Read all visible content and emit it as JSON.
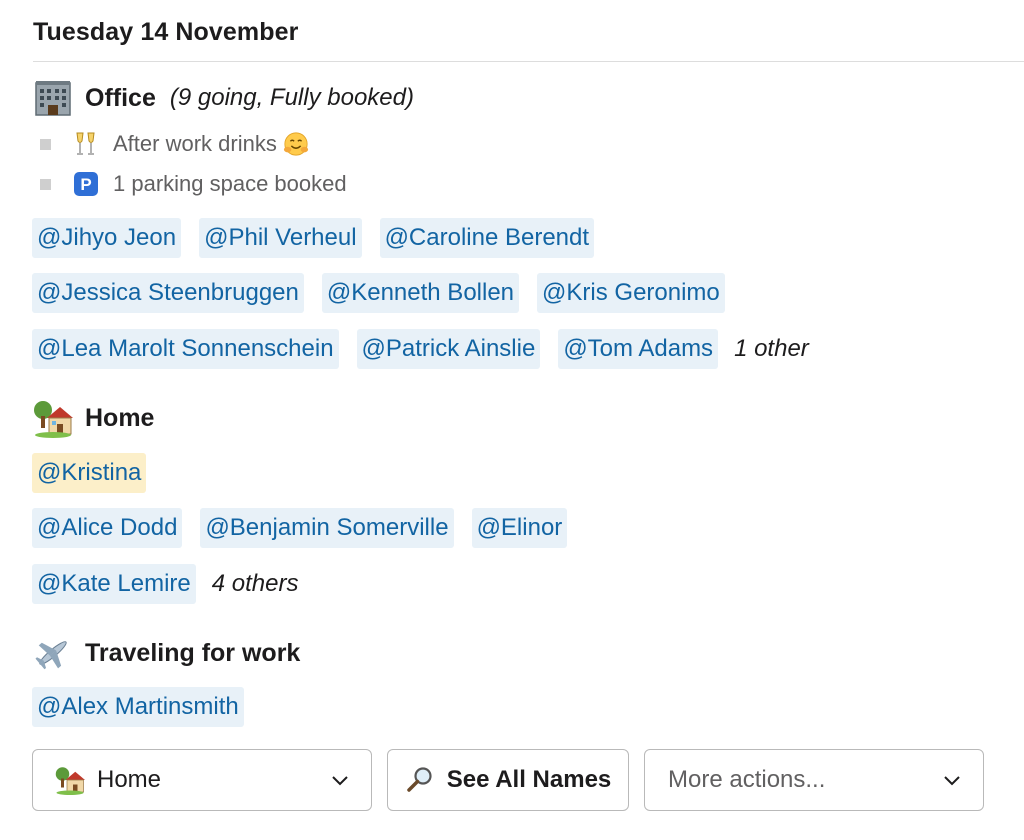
{
  "date_header": "Tuesday 14 November",
  "office": {
    "title": "Office",
    "note": "(9 going, Fully booked)",
    "icon": "office-building-icon",
    "bullets": [
      {
        "icon": "champagne-icon",
        "text": "After work drinks",
        "trailing_icon": "hugging-face-icon"
      },
      {
        "icon": "parking-icon",
        "text": "1 parking space booked"
      }
    ],
    "rows": [
      [
        "@Jihyo Jeon",
        "@Phil Verheul",
        "@Caroline Berendt"
      ],
      [
        "@Jessica Steenbruggen",
        "@Kenneth Bollen",
        "@Kris Geronimo"
      ],
      [
        "@Lea Marolt Sonnenschein",
        "@Patrick Ainslie",
        "@Tom Adams"
      ]
    ],
    "others": "1 other"
  },
  "home": {
    "title": "Home",
    "icon": "house-with-garden-icon",
    "self_mention": "@Kristina",
    "rows": [
      [
        "@Alice Dodd",
        "@Benjamin Somerville",
        "@Elinor"
      ],
      [
        "@Kate Lemire"
      ]
    ],
    "others": "4 others"
  },
  "travel": {
    "title": "Traveling for work",
    "icon": "airplane-icon",
    "rows": [
      [
        "@Alex Martinsmith"
      ]
    ]
  },
  "actions": {
    "status_select": {
      "value": "Home",
      "icon": "house-with-garden-icon"
    },
    "see_all_label": "See All Names",
    "see_all_icon": "magnifying-glass-icon",
    "more_actions_placeholder": "More actions..."
  },
  "colors": {
    "mention_bg": "#e8f1f8",
    "mention_text": "#1264a3",
    "self_mention_bg": "#fcefc9"
  }
}
